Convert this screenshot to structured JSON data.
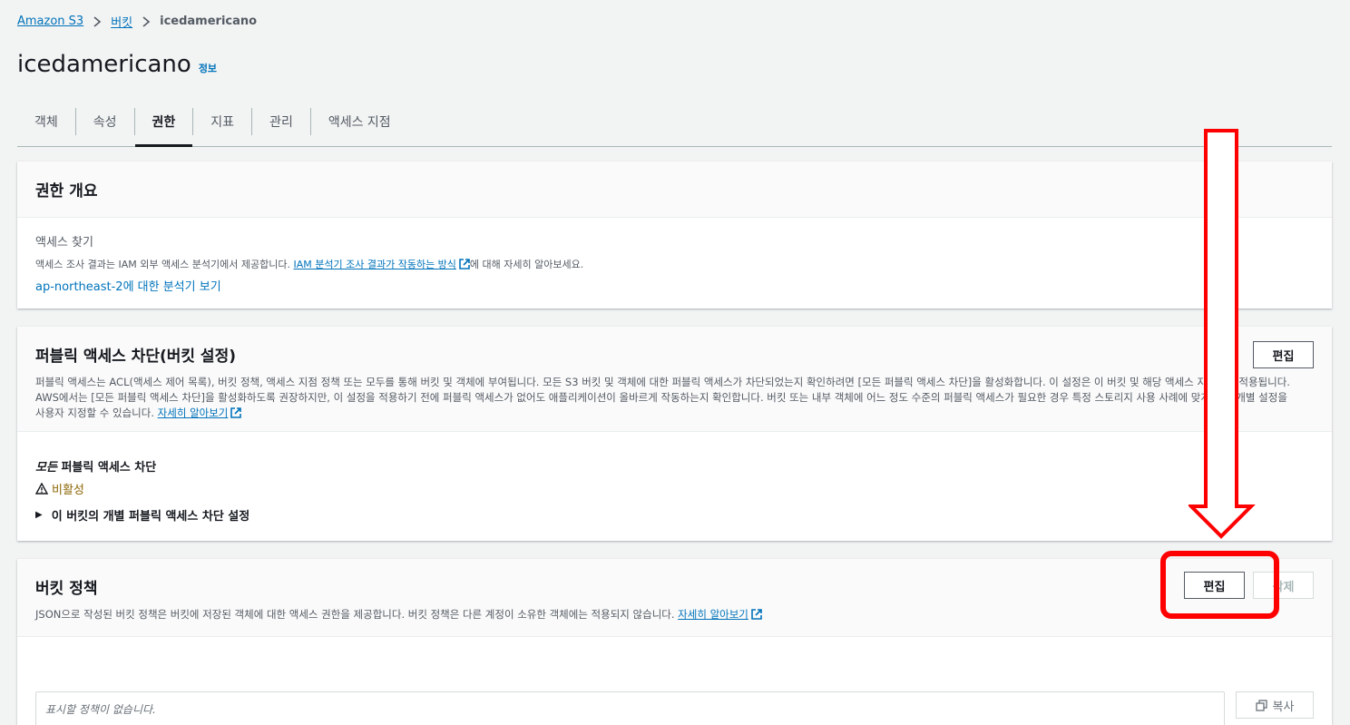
{
  "breadcrumb": {
    "root": "Amazon S3",
    "buckets": "버킷",
    "current": "icedamericano"
  },
  "page": {
    "title": "icedamericano",
    "info": "정보"
  },
  "tabs": [
    {
      "label": "객체"
    },
    {
      "label": "속성"
    },
    {
      "label": "권한"
    },
    {
      "label": "지표"
    },
    {
      "label": "관리"
    },
    {
      "label": "액세스 지점"
    }
  ],
  "overview": {
    "title": "권한 개요",
    "access_findings_label": "액세스 찾기",
    "desc_prefix": "액세스 조사 결과는 IAM 외부 액세스 분석기에서 제공합니다.",
    "desc_link": "IAM 분석기 조사 결과가 작동하는 방식",
    "desc_suffix": "에 대해 자세히 알아보세요.",
    "analyzer_link": "ap-northeast-2에 대한 분석기 보기"
  },
  "block_public": {
    "title": "퍼블릭 액세스 차단(버킷 설정)",
    "edit_label": "편집",
    "desc": "퍼블릭 액세스는 ACL(액세스 제어 목록), 버킷 정책, 액세스 지점 정책 또는 모두를 통해 버킷 및 객체에 부여됩니다. 모든 S3 버킷 및 객체에 대한 퍼블릭 액세스가 차단되었는지 확인하려면 [모든 퍼블릭 액세스 차단]을 활성화합니다. 이 설정은 이 버킷 및 해당 액세스 지점에만 적용됩니다. AWS에서는 [모든 퍼블릭 액세스 차단]을 활성화하도록 권장하지만, 이 설정을 적용하기 전에 퍼블릭 액세스가 없어도 애플리케이션이 올바르게 작동하는지 확인합니다. 버킷 또는 내부 객체에 어느 정도 수준의 퍼블릭 액세스가 필요한 경우 특정 스토리지 사용 사례에 맞게 아래 개별 설정을 사용자 지정할 수 있습니다.",
    "learn_more": "자세히 알아보기",
    "block_all_label_italic": "모든",
    "block_all_label_rest": " 퍼블릭 액세스 차단",
    "status": "비활성",
    "expander_label": "이 버킷의 개별 퍼블릭 액세스 차단 설정"
  },
  "bucket_policy": {
    "title": "버킷 정책",
    "desc": "JSON으로 작성된 버킷 정책은 버킷에 저장된 객체에 대한 액세스 권한을 제공합니다. 버킷 정책은 다른 계정이 소유한 객체에는 적용되지 않습니다.",
    "learn_more": "자세히 알아보기",
    "edit_label": "편집",
    "delete_label": "삭제",
    "empty_text": "표시할 정책이 없습니다.",
    "copy_label": "복사"
  },
  "colors": {
    "link": "#0073bb",
    "annotation": "#ff0000",
    "warning": "#8d6605"
  }
}
